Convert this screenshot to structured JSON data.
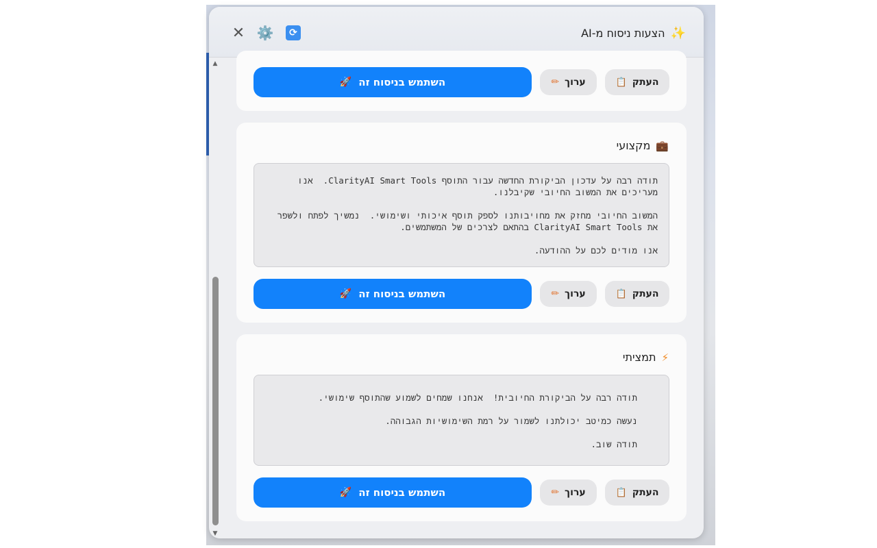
{
  "header": {
    "title": "הצעות ניסוח מ-AI",
    "sparkle_icon": "✨",
    "refresh_icon": "🔄",
    "gear_icon": "⚙️",
    "close_icon": "✕"
  },
  "buttons": {
    "use_label": "השתמש בניסוח זה",
    "edit_label": "ערוך",
    "copy_label": "העתק",
    "rocket_icon": "🚀",
    "pencil_icon": "✏",
    "clipboard_icon": "📋"
  },
  "cards": [
    {
      "title": "מקצועי",
      "icon": "💼",
      "text": "תודה רבה על עדכון הביקורת החדשה עבור התוסף ClarityAI Smart Tools.  אנו מעריכים את המשוב החיובי שקיבלנו.\n\nהמשוב החיובי מחזק את מחויבותנו לספק תוסף איכותי ושימושי.  נמשיך לפתח ולשפר את ClarityAI Smart Tools בהתאם לצרכים של המשתמשים.\n\nאנו מודים לכם על ההודעה."
    },
    {
      "title": "תמציתי",
      "icon": "⚡",
      "text": "תודה רבה על הביקורת החיובית!  אנחנו שמחים לשמוע שהתוסף שימושי.\n\nנעשה כמיטב יכולתנו לשמור על רמת השימושיות הגבוהה.\n\nתודה שוב."
    }
  ]
}
